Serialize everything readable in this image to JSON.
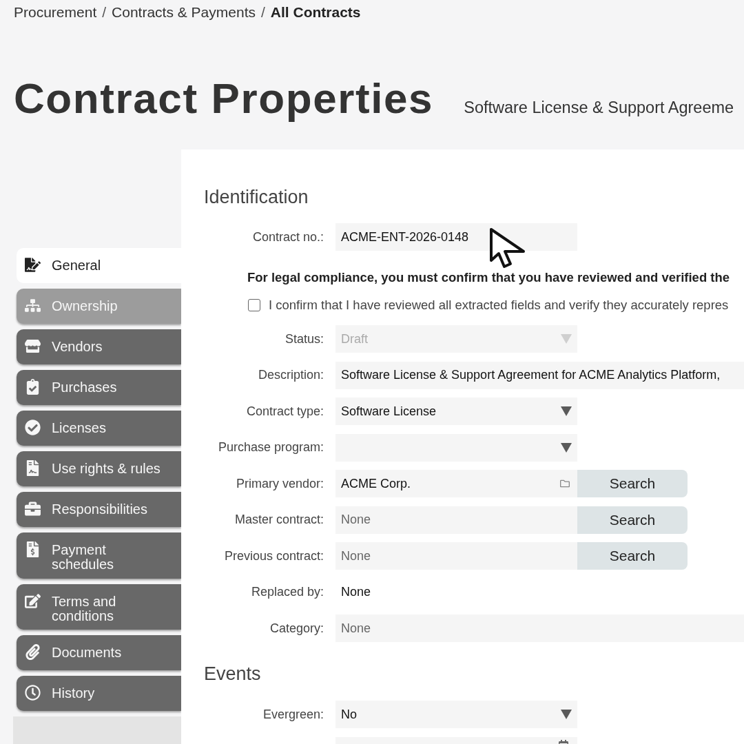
{
  "breadcrumb": [
    {
      "kind": "link",
      "label": "Procurement"
    },
    {
      "kind": "separator",
      "label": "/"
    },
    {
      "kind": "link",
      "label": "Contracts & Payments"
    },
    {
      "kind": "separator",
      "label": "/"
    },
    {
      "kind": "current",
      "label": "All Contracts"
    }
  ],
  "header": {
    "title": "Contract Properties",
    "subtitle": "Software License & Support Agreeme"
  },
  "sidebar": {
    "items": [
      {
        "label": "General",
        "selected": true,
        "hovered": false
      },
      {
        "label": "Ownership",
        "selected": false,
        "hovered": true
      },
      {
        "label": "Vendors",
        "selected": false,
        "hovered": false
      },
      {
        "label": "Purchases",
        "selected": false,
        "hovered": false
      },
      {
        "label": "Licenses",
        "selected": false,
        "hovered": false
      },
      {
        "label": "Use rights & rules",
        "selected": false,
        "hovered": false
      },
      {
        "label": "Responsibilities",
        "selected": false,
        "hovered": false
      },
      {
        "label": "Payment schedules",
        "selected": false,
        "hovered": false
      },
      {
        "label": "Terms and conditions",
        "selected": false,
        "hovered": false
      },
      {
        "label": "Documents",
        "selected": false,
        "hovered": false
      },
      {
        "label": "History",
        "selected": false,
        "hovered": false
      }
    ]
  },
  "sections": [
    {
      "title": "Identification",
      "rows": [
        {
          "kind": "text",
          "label": "Contract no.:",
          "value": "ACME-ENT-2026-0148",
          "disabled": false
        },
        {
          "kind": "notice",
          "text": "For legal compliance, you must confirm that you have reviewed and verified the"
        },
        {
          "kind": "checkbox",
          "label": "I confirm that I have reviewed all extracted fields and verify they accurately repres",
          "checked": false
        },
        {
          "kind": "select",
          "label": "Status:",
          "value": "Draft",
          "disabled": true
        },
        {
          "kind": "long_text",
          "label": "Description:",
          "value": "Software License & Support Agreement for ACME Analytics Platform,",
          "disabled": false
        },
        {
          "kind": "select",
          "label": "Contract type:",
          "value": "Software License",
          "disabled": false
        },
        {
          "kind": "select",
          "label": "Purchase program:",
          "disabled": false
        },
        {
          "kind": "lookup",
          "label": "Primary vendor:",
          "value": "ACME Corp.",
          "button": "Search"
        },
        {
          "kind": "lookup",
          "label": "Master contract:",
          "placeholder": "None",
          "button": "Search"
        },
        {
          "kind": "lookup",
          "label": "Previous contract:",
          "placeholder": "None",
          "button": "Search"
        },
        {
          "kind": "plain",
          "label": "Replaced by:",
          "value": "None"
        },
        {
          "kind": "long_text",
          "label": "Category:",
          "placeholder": "None",
          "disabled": false
        }
      ]
    },
    {
      "title": "Events",
      "rows": [
        {
          "kind": "select",
          "label": "Evergreen:",
          "value": "No",
          "disabled": false
        },
        {
          "kind": "date"
        }
      ]
    }
  ]
}
